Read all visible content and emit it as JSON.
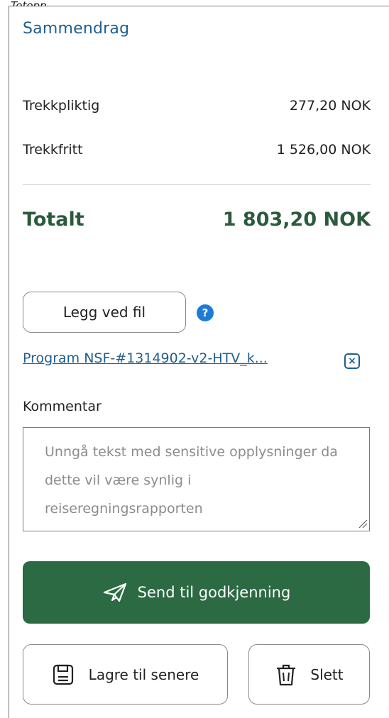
{
  "top_fragment": "Totopp",
  "summary": {
    "title": "Sammendrag",
    "rows": [
      {
        "label": "Trekkpliktig",
        "value": "277,20 NOK"
      },
      {
        "label": "Trekkfritt",
        "value": "1 526,00 NOK"
      }
    ],
    "total_label": "Totalt",
    "total_value": "1 803,20 NOK"
  },
  "attachments": {
    "attach_label": "Legg ved fil",
    "help_symbol": "?",
    "file_name": "Program NSF-#1314902-v2-HTV_k...",
    "remove_symbol": "×"
  },
  "comment": {
    "label": "Kommentar",
    "value": "",
    "placeholder": "Unngå tekst med sensitive opplysninger da dette vil være synlig i reiseregningsrapporten"
  },
  "actions": {
    "send_label": "Send til godkjenning",
    "save_label": "Lagre til senere",
    "delete_label": "Slett"
  },
  "colors": {
    "title": "#1f5f8f",
    "total": "#2b5a3c",
    "primary_button": "#2b6a43",
    "help_icon": "#1e7bd6",
    "link": "#1f5f8f"
  },
  "icons": {
    "help": "question-circle-icon",
    "remove": "close-box-icon",
    "send": "paper-plane-icon",
    "save": "floppy-disk-icon",
    "delete": "trash-icon"
  }
}
